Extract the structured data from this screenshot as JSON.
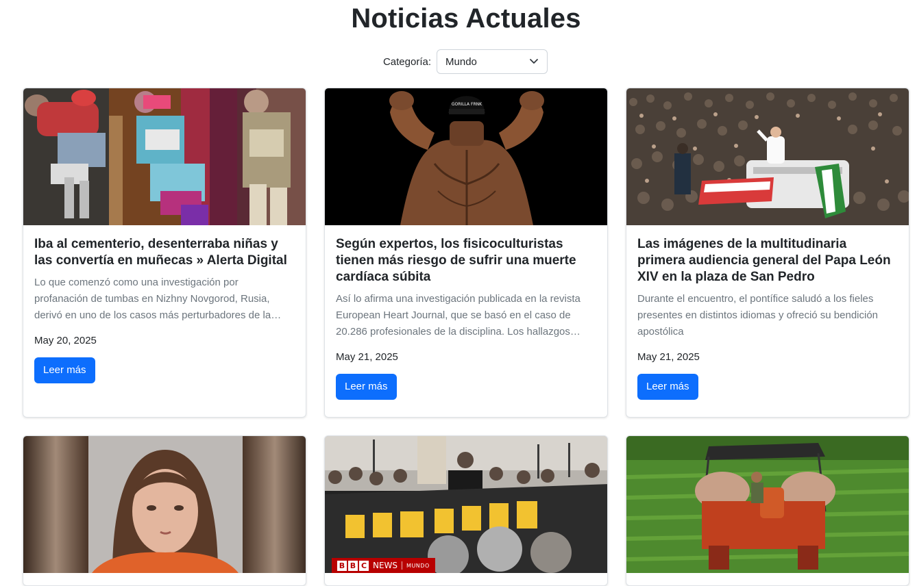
{
  "page": {
    "title": "Noticias Actuales"
  },
  "filter": {
    "label": "Categoría:",
    "selected": "Mundo",
    "icon": "chevron-down-icon"
  },
  "cards": [
    {
      "title": "Iba al cementerio, desenterraba niñas y las convertía en muñecas » Alerta Digital",
      "description": "Lo que comenzó como una investigación por profanación de tumbas en Nizhny Novgorod, Rusia, derivó en uno de los casos más perturbadores de la…",
      "date": "May 20, 2025",
      "button": "Leer más"
    },
    {
      "title": "Según expertos, los fisicoculturistas tienen más riesgo de sufrir una muerte cardíaca súbita",
      "description": "Así lo afirma una investigación publicada en la revista European Heart Journal, que se basó en el caso de 20.286 profesionales de la disciplina. Los hallazgos…",
      "date": "May 21, 2025",
      "button": "Leer más",
      "cap_text": "GORILLA FRNK"
    },
    {
      "title": "Las imágenes de la multitudinaria primera audiencia general del Papa León XIV en la plaza de San Pedro",
      "description": "Durante el encuentro, el pontífice saludó a los fieles presentes en distintos idiomas y ofreció su bendición apostólica",
      "date": "May 21, 2025",
      "button": "Leer más"
    },
    {
      "title": "",
      "description": "",
      "date": "",
      "button": ""
    },
    {
      "title": "",
      "description": "",
      "date": "",
      "button": "",
      "badge": {
        "brand": "BBC",
        "news": "NEWS",
        "section": "MUNDO"
      }
    },
    {
      "title": "",
      "description": "",
      "date": "",
      "button": ""
    }
  ],
  "colors": {
    "primary": "#0d6efd",
    "text": "#212529",
    "muted": "#6c757d",
    "bbc_red": "#b80000"
  }
}
